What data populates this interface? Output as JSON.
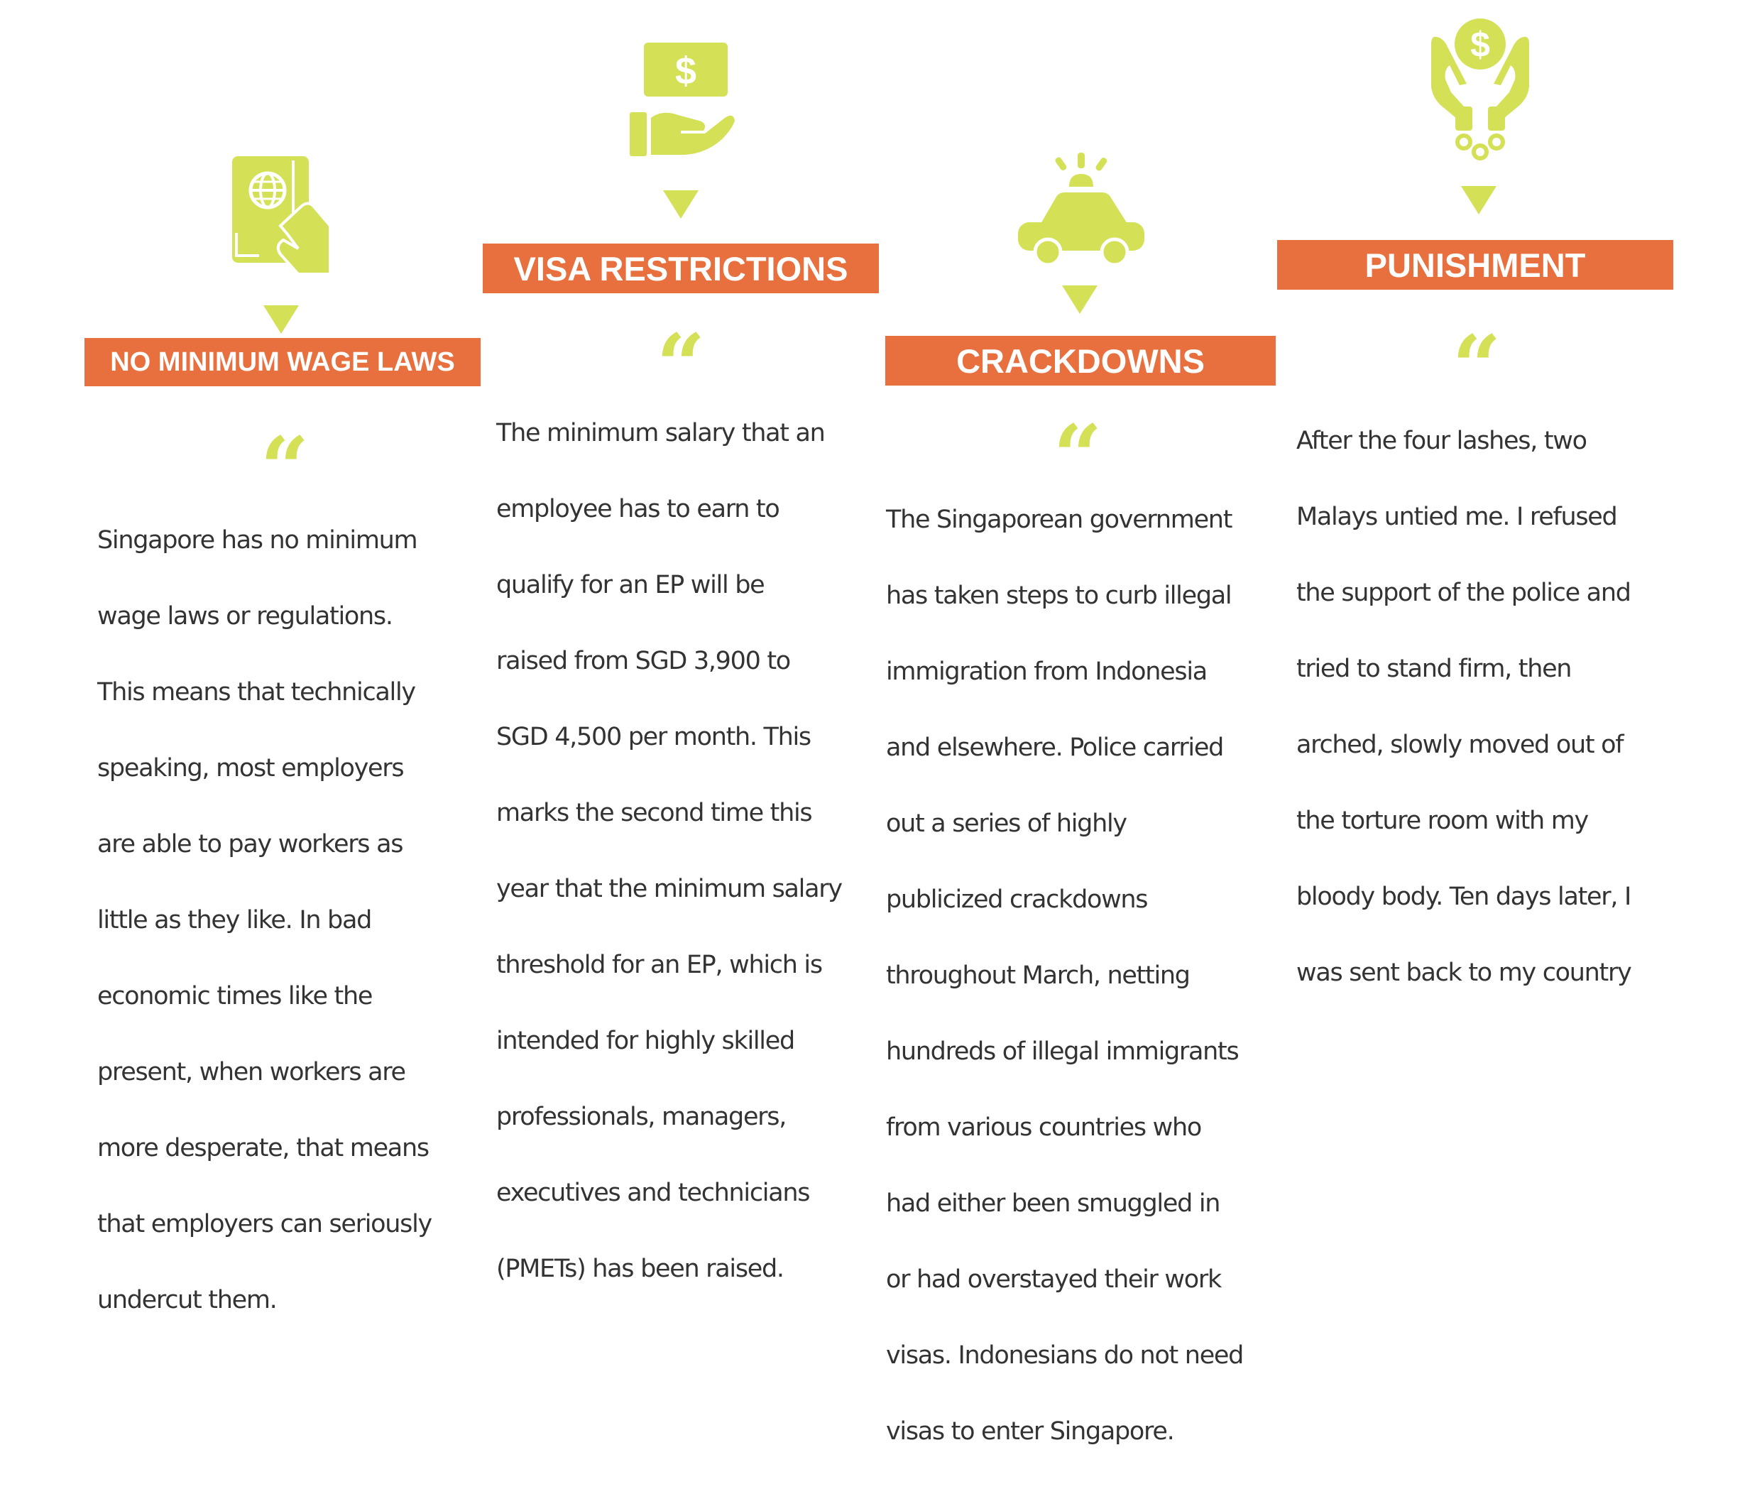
{
  "colors": {
    "accent_green": "#d4e157",
    "banner_orange": "#e8703f",
    "text": "#333333"
  },
  "columns": [
    {
      "icon": "passport-icon",
      "title": "NO MINIMUM WAGE LAWS",
      "lines": [
        "Singapore has no minimum",
        "wage laws or regulations.",
        "This means that technically",
        "speaking, most employers",
        "are able to pay workers as",
        "little as they like. In bad",
        "economic times like the",
        "present, when workers are",
        "more desperate, that means",
        "that employers can seriously",
        "undercut them."
      ]
    },
    {
      "icon": "hand-holding-money-icon",
      "title": "VISA RESTRICTIONS",
      "lines": [
        "The minimum salary that an",
        "employee has to earn to",
        "qualify for an EP will be",
        "raised from SGD 3,900 to",
        "SGD 4,500 per month.  This",
        "marks the second time this",
        "year that the minimum salary",
        "threshold for an EP, which is",
        "intended for highly skilled",
        "professionals, managers,",
        "executives and technicians",
        "(PMETs) has been raised."
      ]
    },
    {
      "icon": "police-car-icon",
      "title": "CRACKDOWNS",
      "lines": [
        "The Singaporean government",
        "has taken steps to curb illegal",
        "immigration from Indonesia",
        "and elsewhere. Police carried",
        "out a series of highly",
        "publicized crackdowns",
        "throughout March, netting",
        "hundreds of illegal immigrants",
        "from various countries who",
        "had either been smuggled in",
        "or had overstayed their work",
        "visas. Indonesians do not need",
        "visas to enter Singapore."
      ]
    },
    {
      "icon": "handcuffs-money-icon",
      "title": "PUNISHMENT",
      "lines": [
        "After the four lashes, two",
        "Malays untied me. I refused",
        "the support of the police and",
        "tried to stand firm, then",
        "arched, slowly moved out of",
        "the torture room with my",
        "bloody body. Ten days later, I",
        "was sent back to my country"
      ]
    }
  ],
  "quote_glyph": "“"
}
